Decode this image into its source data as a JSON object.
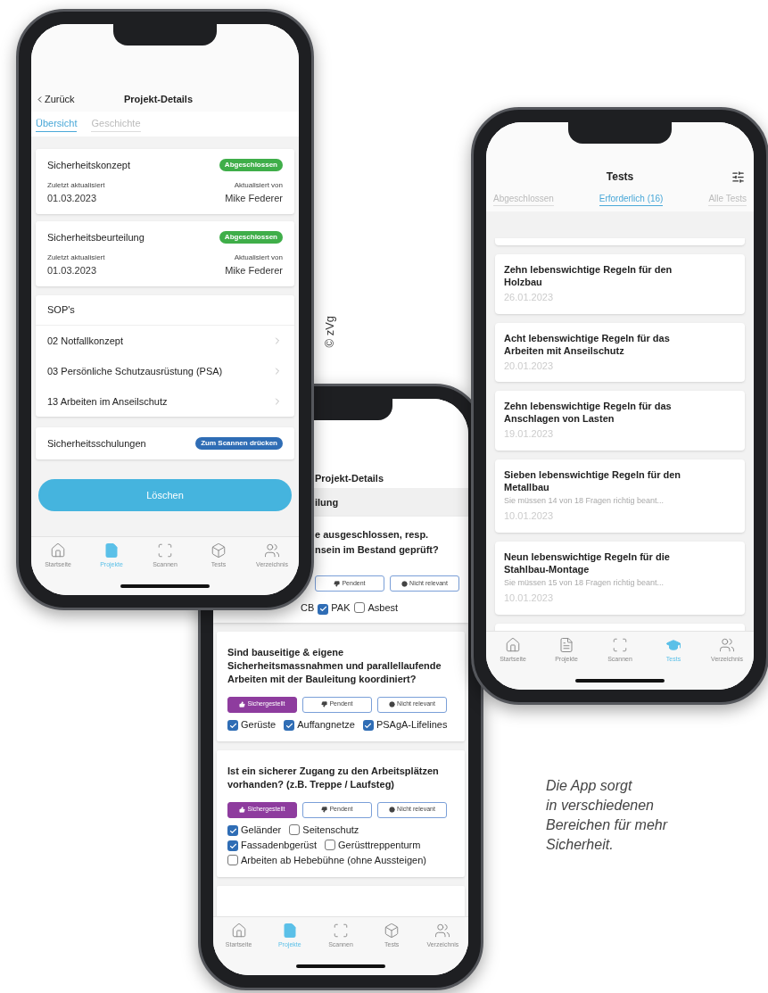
{
  "left_phone": {
    "back": "Zurück",
    "title": "Projekt-Details",
    "tabs": [
      {
        "label": "Übersicht",
        "selected": true
      },
      {
        "label": "Geschichte",
        "selected": false
      }
    ],
    "cards": [
      {
        "title": "Sicherheitskonzept",
        "badge": "Abgeschlossen",
        "updated_label": "Zuletzt aktualisiert",
        "updated_date": "01.03.2023",
        "by_label": "Aktualisiert von",
        "by_name": "Mike Federer"
      },
      {
        "title": "Sicherheitsbeurteilung",
        "badge": "Abgeschlossen",
        "updated_label": "Zuletzt aktualisiert",
        "updated_date": "01.03.2023",
        "by_label": "Aktualisiert von",
        "by_name": "Mike Federer"
      }
    ],
    "sops": {
      "heading": "SOP's",
      "items": [
        "02 Notfallkonzept",
        "03 Persönliche Schutzausrüstung (PSA)",
        "13 Arbeiten im Anseilschutz"
      ]
    },
    "trainings": {
      "label": "Sicherheitsschulungen",
      "badge": "Zum Scannen drücken"
    },
    "delete_button": "Löschen",
    "nav": [
      {
        "label": "Startseite",
        "selected": false
      },
      {
        "label": "Projekte",
        "selected": true
      },
      {
        "label": "Scannen",
        "selected": false
      },
      {
        "label": "Tests",
        "selected": false
      },
      {
        "label": "Verzeichnis",
        "selected": false
      }
    ]
  },
  "middle_phone": {
    "title": "Projekt-Details",
    "section": "ilung",
    "first_question": {
      "lines": [
        "e ausgeschlossen, resp.",
        "nsein im Bestand geprüft?"
      ],
      "buttons": [
        {
          "label": "Pendent",
          "selected": false
        },
        {
          "label": "Nicht relevant",
          "selected": false
        }
      ],
      "leading_text": "CB",
      "options": [
        {
          "label": "PAK",
          "checked": true
        },
        {
          "label": "Asbest",
          "checked": false
        }
      ]
    },
    "questions": [
      {
        "text": "Sind bauseitige & eigene Sicherheitsmassnahmen und parallellaufende Arbeiten mit der Bauleitung koordiniert?",
        "buttons": [
          {
            "label": "Sichergestellt",
            "selected": true
          },
          {
            "label": "Pendent",
            "selected": false
          },
          {
            "label": "Nicht relevant",
            "selected": false
          }
        ],
        "options": [
          {
            "label": "Gerüste",
            "checked": true
          },
          {
            "label": "Auffangnetze",
            "checked": true
          },
          {
            "label": "PSAgA-Lifelines",
            "checked": true
          }
        ]
      },
      {
        "text": "Ist ein sicherer Zugang zu den Arbeitsplätzen vorhanden? (z.B. Treppe / Laufsteg)",
        "buttons": [
          {
            "label": "Sichergestellt",
            "selected": true
          },
          {
            "label": "Pendent",
            "selected": false
          },
          {
            "label": "Nicht relevant",
            "selected": false
          }
        ],
        "options": [
          {
            "label": "Geländer",
            "checked": true
          },
          {
            "label": "Seitenschutz",
            "checked": false
          },
          {
            "label": "Fassadenbgerüst",
            "checked": true
          },
          {
            "label": "Gerüsttreppenturm",
            "checked": false
          },
          {
            "label": "Arbeiten ab Hebebühne (ohne Aussteigen)",
            "checked": false
          }
        ]
      }
    ],
    "nav": [
      {
        "label": "Startseite",
        "selected": false
      },
      {
        "label": "Projekte",
        "selected": true
      },
      {
        "label": "Scannen",
        "selected": false
      },
      {
        "label": "Tests",
        "selected": false
      },
      {
        "label": "Verzeichnis",
        "selected": false
      }
    ]
  },
  "right_phone": {
    "title": "Tests",
    "tabs": [
      {
        "label": "Abgeschlossen",
        "selected": false
      },
      {
        "label": "Erforderlich (16)",
        "selected": true
      },
      {
        "label": "Alle Tests",
        "selected": false
      }
    ],
    "tests": [
      {
        "title": "Zehn lebenswichtige Regeln für den Holzbau",
        "date": "26.01.2023"
      },
      {
        "title": "Acht lebenswichtige Regeln für das Arbeiten mit Anseilschutz",
        "date": "20.01.2023"
      },
      {
        "title": "Zehn lebenswichtige Regeln für das Anschlagen von Lasten",
        "date": "19.01.2023"
      },
      {
        "title": "Sieben lebenswichtige Regeln für den Metallbau",
        "note": "Sie müssen 14 von 18 Fragen richtig beant...",
        "date": "10.01.2023"
      },
      {
        "title": "Neun lebenswichtige Regeln für die Stahlbau-Montage",
        "note": "Sie müssen 15 von 18 Fragen richtig beant...",
        "date": "10.01.2023"
      }
    ],
    "nav": [
      {
        "label": "Startseite",
        "selected": false
      },
      {
        "label": "Projekte",
        "selected": false
      },
      {
        "label": "Scannen",
        "selected": false
      },
      {
        "label": "Tests",
        "selected": true
      },
      {
        "label": "Verzeichnis",
        "selected": false
      }
    ]
  },
  "copyright": "© zVg",
  "caption": [
    "Die App sorgt",
    "in verschiedenen",
    "Bereichen für mehr",
    "Sicherheit."
  ]
}
